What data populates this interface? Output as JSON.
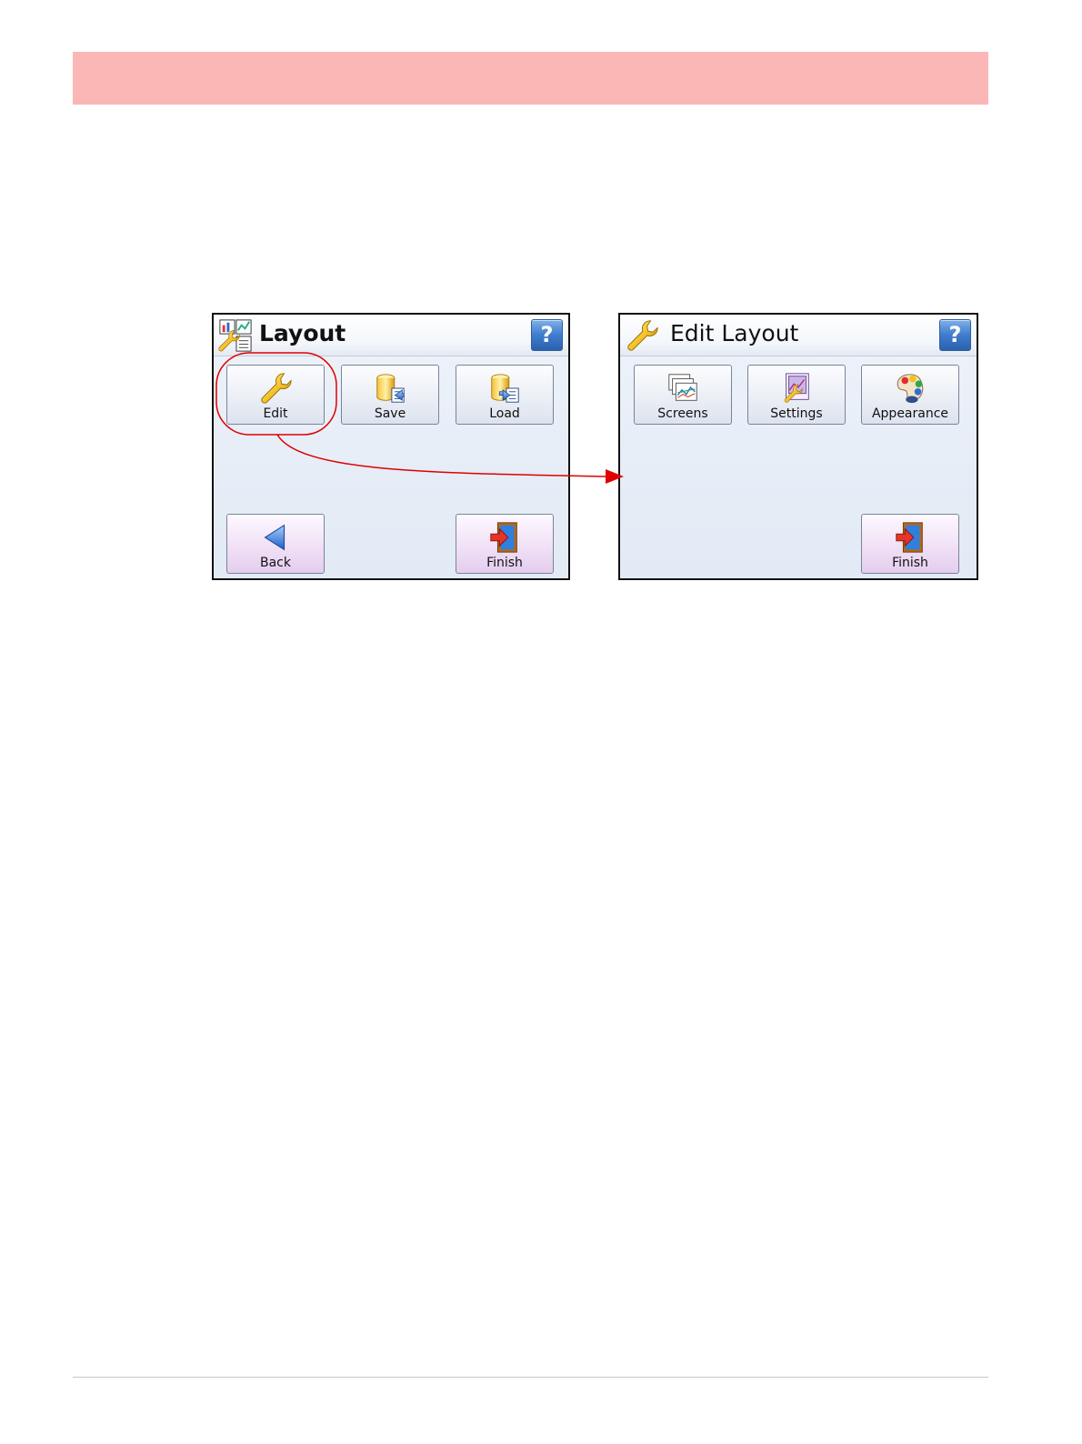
{
  "colors": {
    "header_band": "#fbb6b6",
    "annotation": "#e00000",
    "button_standard": "#eef1f7",
    "button_nav": "#f2e3f7",
    "help_button": "#3f7ccc"
  },
  "layout_screen": {
    "title": "Layout",
    "title_icon": "layout-wrench-icon",
    "help_label": "?",
    "buttons": [
      {
        "label": "Edit",
        "icon": "wrench-icon"
      },
      {
        "label": "Save",
        "icon": "save-database-icon"
      },
      {
        "label": "Load",
        "icon": "load-database-icon"
      }
    ],
    "nav": {
      "back": {
        "label": "Back",
        "icon": "back-arrow-icon"
      },
      "finish": {
        "label": "Finish",
        "icon": "exit-door-icon"
      }
    }
  },
  "edit_layout_screen": {
    "title": "Edit Layout",
    "title_icon": "wrench-icon",
    "help_label": "?",
    "buttons": [
      {
        "label": "Screens",
        "icon": "screens-icon"
      },
      {
        "label": "Settings",
        "icon": "settings-icon"
      },
      {
        "label": "Appearance",
        "icon": "palette-icon"
      }
    ],
    "nav": {
      "finish": {
        "label": "Finish",
        "icon": "exit-door-icon"
      }
    }
  },
  "annotation": {
    "highlight": "edit-button",
    "points_to": "edit-layout-screen"
  }
}
